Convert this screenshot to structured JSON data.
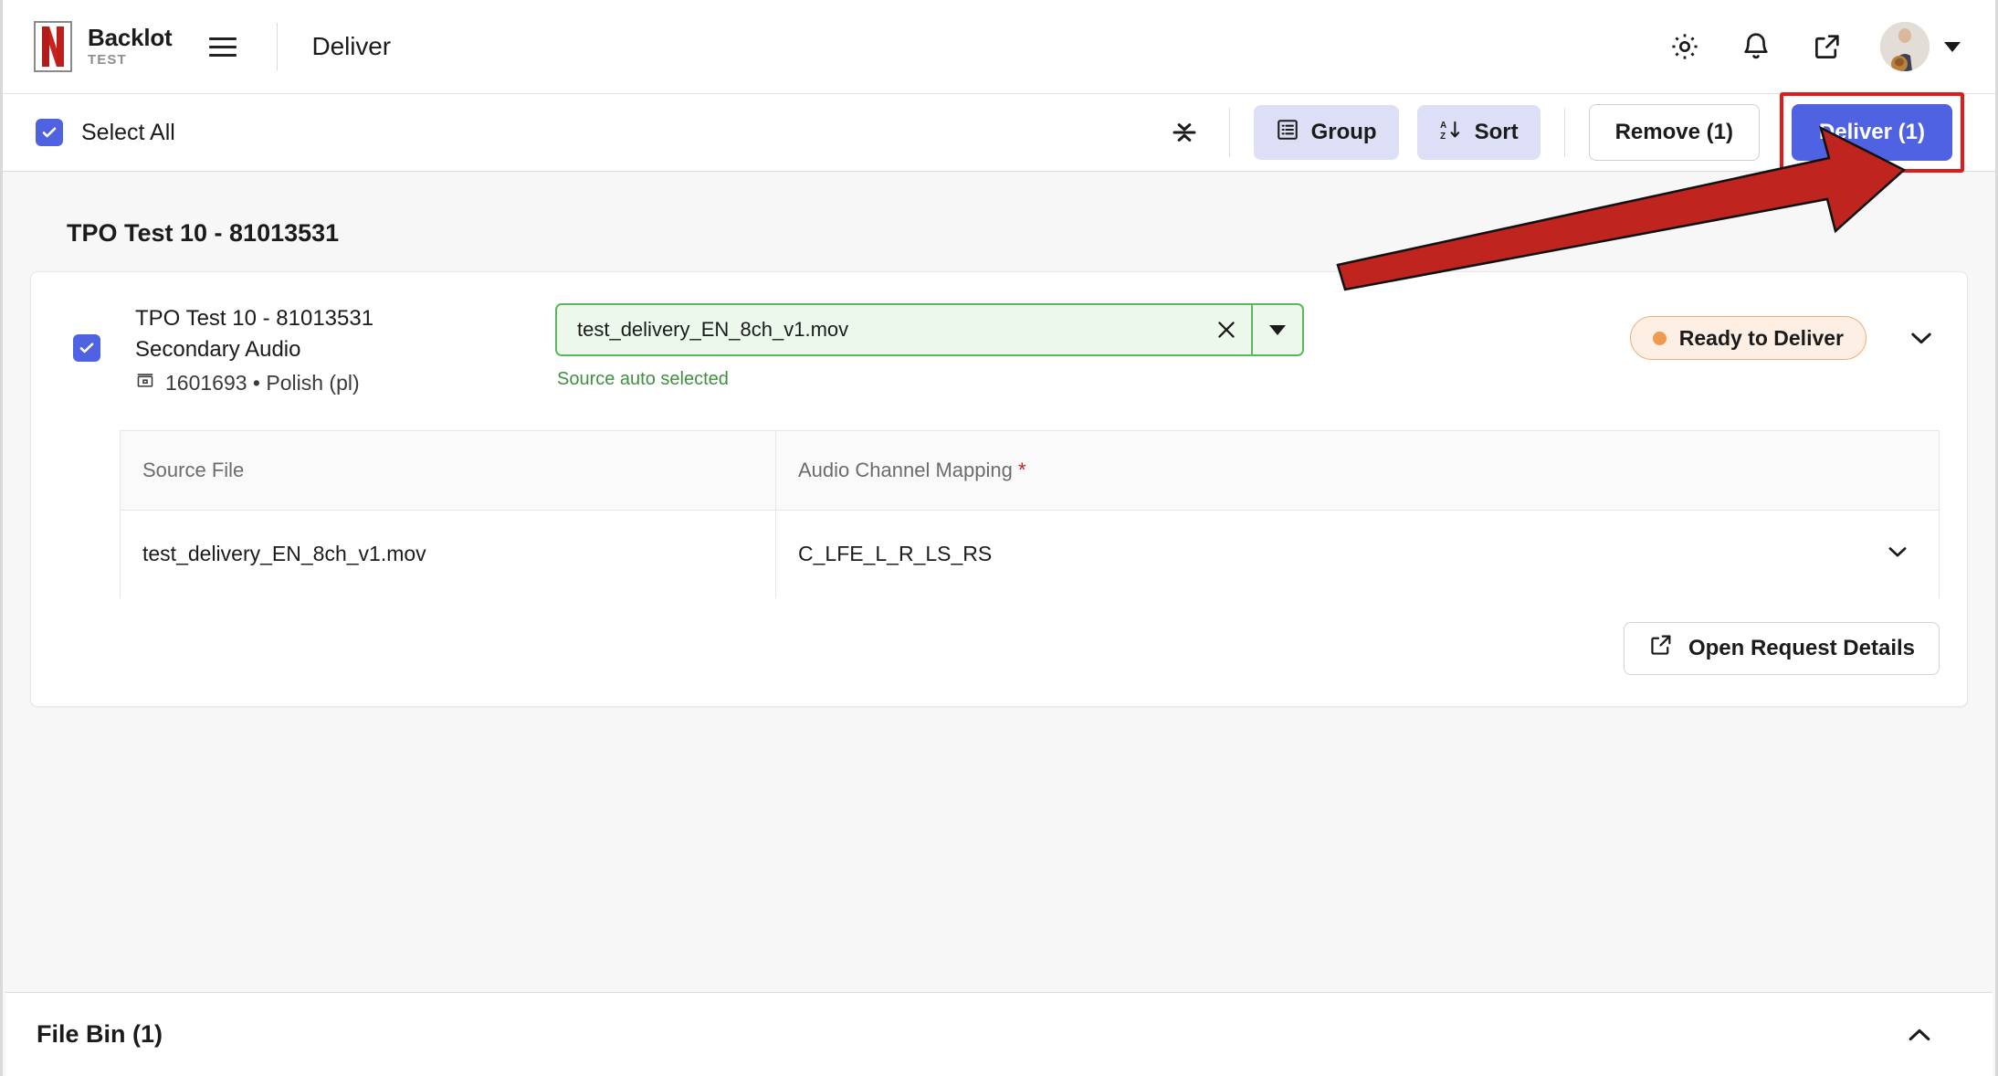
{
  "header": {
    "brand_title": "Backlot",
    "brand_subtitle": "TEST",
    "page_title": "Deliver",
    "icons": {
      "menu": "hamburger-menu-icon",
      "settings": "gear-icon",
      "notifications": "bell-icon",
      "open_external": "external-link-icon",
      "avatar": "user-avatar",
      "account_caret": "chevron-down-icon"
    }
  },
  "actionbar": {
    "select_all_label": "Select All",
    "collapse_icon": "collapse-all-icon",
    "group_label": "Group",
    "sort_label": "Sort",
    "remove_label": "Remove (1)",
    "deliver_label": "Deliver (1)"
  },
  "main": {
    "group_heading": "TPO Test 10 - 81013531",
    "item": {
      "title": "TPO Test 10 - 81013531",
      "subtitle": "Secondary Audio",
      "meta": "1601693 • Polish (pl)",
      "source_value": "test_delivery_EN_8ch_v1.mov",
      "source_helper": "Source auto selected",
      "status": "Ready to Deliver"
    },
    "table": {
      "headers": [
        "Source File",
        "Audio Channel Mapping"
      ],
      "required_marker": "*",
      "rows": [
        {
          "source_file": "test_delivery_EN_8ch_v1.mov",
          "audio_channel_mapping": "C_LFE_L_R_LS_RS"
        }
      ]
    },
    "open_request_details_label": "Open Request Details"
  },
  "footer": {
    "file_bin_label": "File Bin (1)",
    "collapse_icon": "chevron-up-icon"
  },
  "colors": {
    "primary": "#4f62e2",
    "primary_soft": "#dcdff6",
    "netflix_red": "#c9231f",
    "status_border": "#efae79",
    "status_bg": "#fdefe4",
    "status_dot": "#ef9a4e",
    "select_green": "#5cb85c",
    "select_green_bg": "#edf8ed",
    "helper_green": "#3f8f3f",
    "annotation_red": "#c0241f",
    "required_red": "#c0241f"
  }
}
